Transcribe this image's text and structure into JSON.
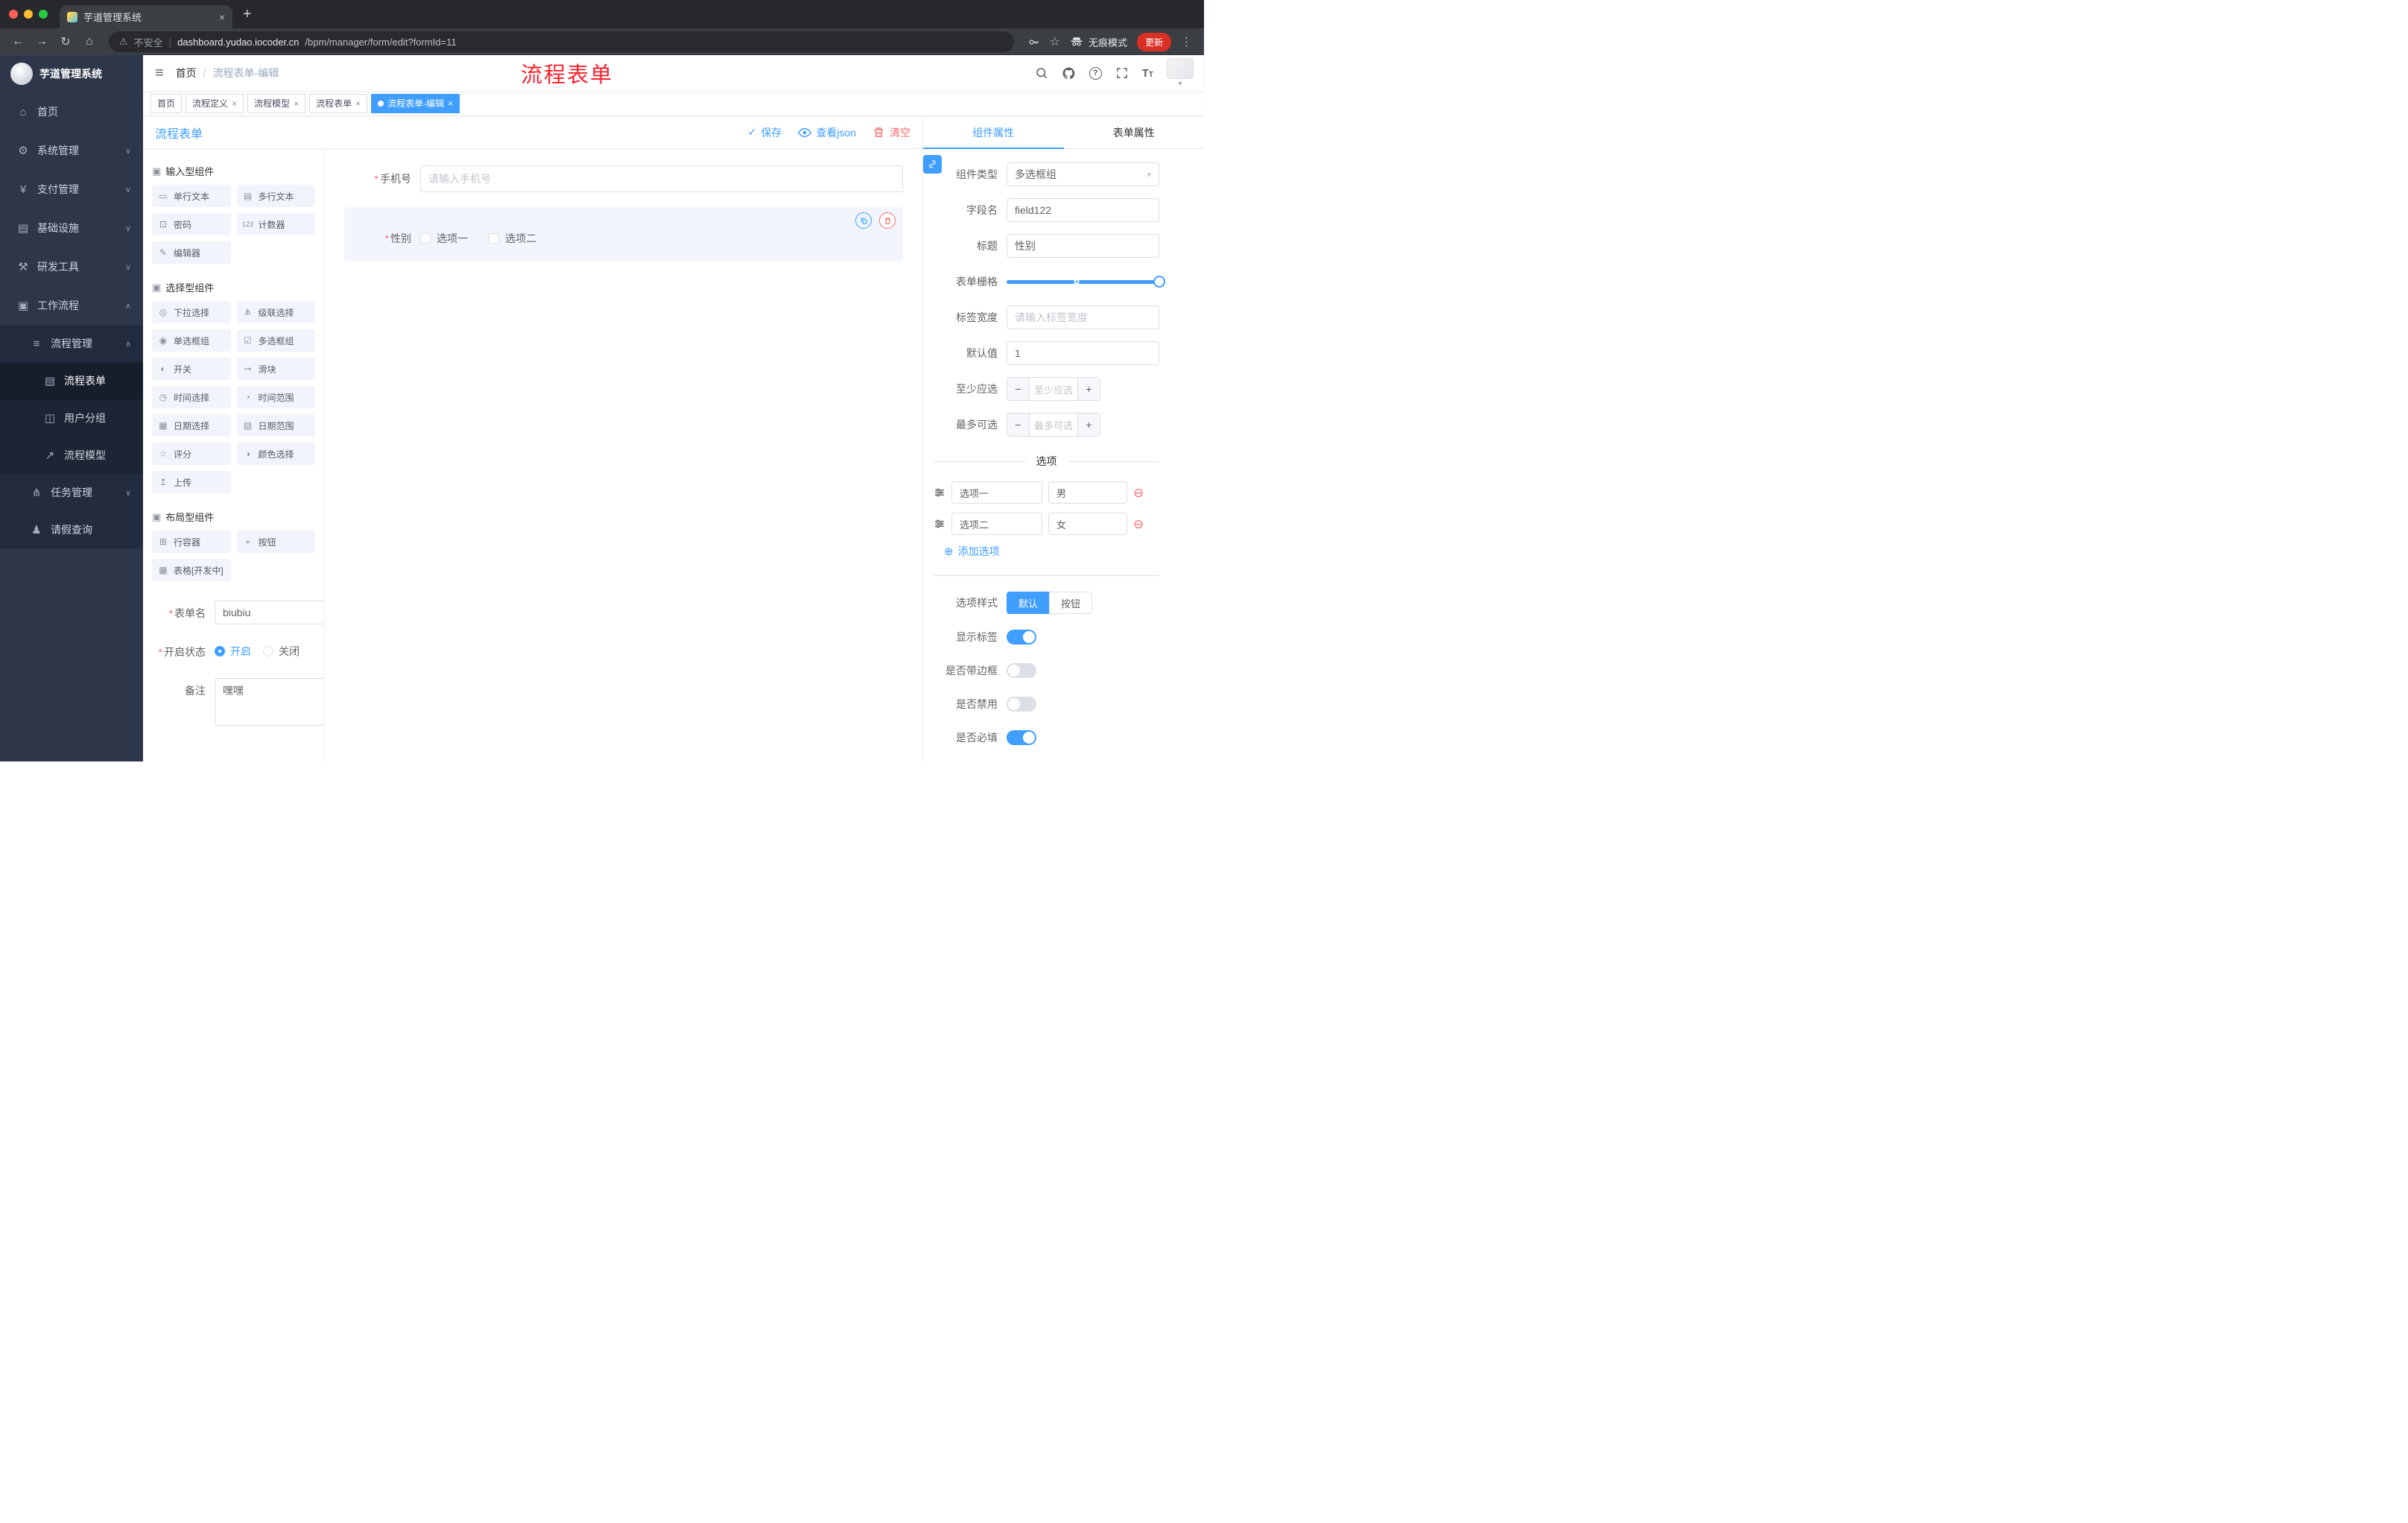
{
  "browser": {
    "tab_title": "芋道管理系统",
    "security_label": "不安全",
    "url_host": "dashboard.yudao.iocoder.cn",
    "url_path": "/bpm/manager/form/edit?formId=11",
    "incognito_label": "无痕模式",
    "update_label": "更新"
  },
  "icons": {
    "close": "×",
    "plus": "+",
    "back": "←",
    "forward": "→",
    "reload": "↻",
    "home": "⌂",
    "warning": "⚠",
    "star": "☆",
    "kebab": "⋮",
    "hamburger": "≡",
    "slash": "/",
    "chevron_down": "∨",
    "chevron_up": "∧",
    "caret_down": "▾",
    "check": "✓",
    "add_circle": "⊕",
    "remove_circle": "⊖",
    "asterisk": "*",
    "dot_minus": "−",
    "dot_plus": "+"
  },
  "sidebar": {
    "title": "芋道管理系统",
    "items": [
      {
        "label": "首页",
        "icon": "⌂"
      },
      {
        "label": "系统管理",
        "icon": "⚙"
      },
      {
        "label": "支付管理",
        "icon": "¥"
      },
      {
        "label": "基础设施",
        "icon": "▤"
      },
      {
        "label": "研发工具",
        "icon": "⚒"
      },
      {
        "label": "工作流程",
        "icon": "▣"
      },
      {
        "label": "流程管理",
        "icon": "≡"
      },
      {
        "label": "流程表单",
        "icon": "▤"
      },
      {
        "label": "用户分组",
        "icon": "◫"
      },
      {
        "label": "流程模型",
        "icon": "↗"
      },
      {
        "label": "任务管理",
        "icon": "⋔"
      },
      {
        "label": "请假查询",
        "icon": "♟"
      }
    ]
  },
  "header": {
    "breadcrumb_home": "首页",
    "breadcrumb_current": "流程表单-编辑",
    "watermark": "流程表单"
  },
  "tags": [
    {
      "label": "首页"
    },
    {
      "label": "流程定义"
    },
    {
      "label": "流程模型"
    },
    {
      "label": "流程表单"
    },
    {
      "label": "流程表单-编辑"
    }
  ],
  "board": {
    "title": "流程表单",
    "save": "保存",
    "view_json": "查看json",
    "clear": "清空"
  },
  "palette": {
    "groups": [
      {
        "title": "输入型组件",
        "icon": "▣",
        "items": [
          {
            "label": "单行文本",
            "icon": "▭"
          },
          {
            "label": "多行文本",
            "icon": "▤"
          },
          {
            "label": "密码",
            "icon": "⊡"
          },
          {
            "label": "计数器",
            "icon": "123"
          },
          {
            "label": "编辑器",
            "icon": "✎"
          }
        ]
      },
      {
        "title": "选择型组件",
        "icon": "▣",
        "items": [
          {
            "label": "下拉选择",
            "icon": "◎"
          },
          {
            "label": "级联选择",
            "icon": "⋔"
          },
          {
            "label": "单选框组",
            "icon": "◉"
          },
          {
            "label": "多选框组",
            "icon": "☑"
          },
          {
            "label": "开关",
            "icon": "◐"
          },
          {
            "label": "滑块",
            "icon": "⊸"
          },
          {
            "label": "时间选择",
            "icon": "◷"
          },
          {
            "label": "时间范围",
            "icon": "◔"
          },
          {
            "label": "日期选择",
            "icon": "▦"
          },
          {
            "label": "日期范围",
            "icon": "▧"
          },
          {
            "label": "评分",
            "icon": "☆"
          },
          {
            "label": "颜色选择",
            "icon": "◑"
          },
          {
            "label": "上传",
            "icon": "↥"
          }
        ]
      },
      {
        "title": "布局型组件",
        "icon": "▣",
        "items": [
          {
            "label": "行容器",
            "icon": "⊞"
          },
          {
            "label": "按钮",
            "icon": "⌖"
          },
          {
            "label": "表格[开发中]",
            "icon": "▦"
          }
        ]
      }
    ],
    "form": {
      "name_label": "表单名",
      "name_value": "biubiu",
      "status_label": "开启状态",
      "status_on": "开启",
      "status_off": "关闭",
      "remark_label": "备注",
      "remark_value": "嘿嘿"
    }
  },
  "canvas": {
    "phone_label": "手机号",
    "phone_placeholder": "请输入手机号",
    "gender_label": "性别",
    "gender_opt1": "选项一",
    "gender_opt2": "选项二"
  },
  "props": {
    "tab_component": "组件属性",
    "tab_form": "表单属性",
    "component_type_label": "组件类型",
    "component_type_value": "多选框组",
    "field_label": "字段名",
    "field_value": "field122",
    "title_label": "标题",
    "title_value": "性别",
    "grid_label": "表单栅格",
    "label_width_label": "标签宽度",
    "label_width_placeholder": "请输入标签宽度",
    "default_label": "默认值",
    "default_value": "1",
    "min_label": "至少应选",
    "min_placeholder": "至少应选",
    "max_label": "最多可选",
    "max_placeholder": "最多可选",
    "options_title": "选项",
    "options": [
      {
        "label": "选项一",
        "value": "男"
      },
      {
        "label": "选项二",
        "value": "女"
      }
    ],
    "add_option": "添加选项",
    "style_label": "选项样式",
    "style_default": "默认",
    "style_button": "按钮",
    "toggles": [
      {
        "label": "显示标签",
        "on": true
      },
      {
        "label": "是否带边框",
        "on": false
      },
      {
        "label": "是否禁用",
        "on": false
      },
      {
        "label": "是否必填",
        "on": true
      }
    ]
  },
  "colors": {
    "primary": "#409eff",
    "danger": "#f56c6c",
    "watermark": "#f5222d"
  }
}
